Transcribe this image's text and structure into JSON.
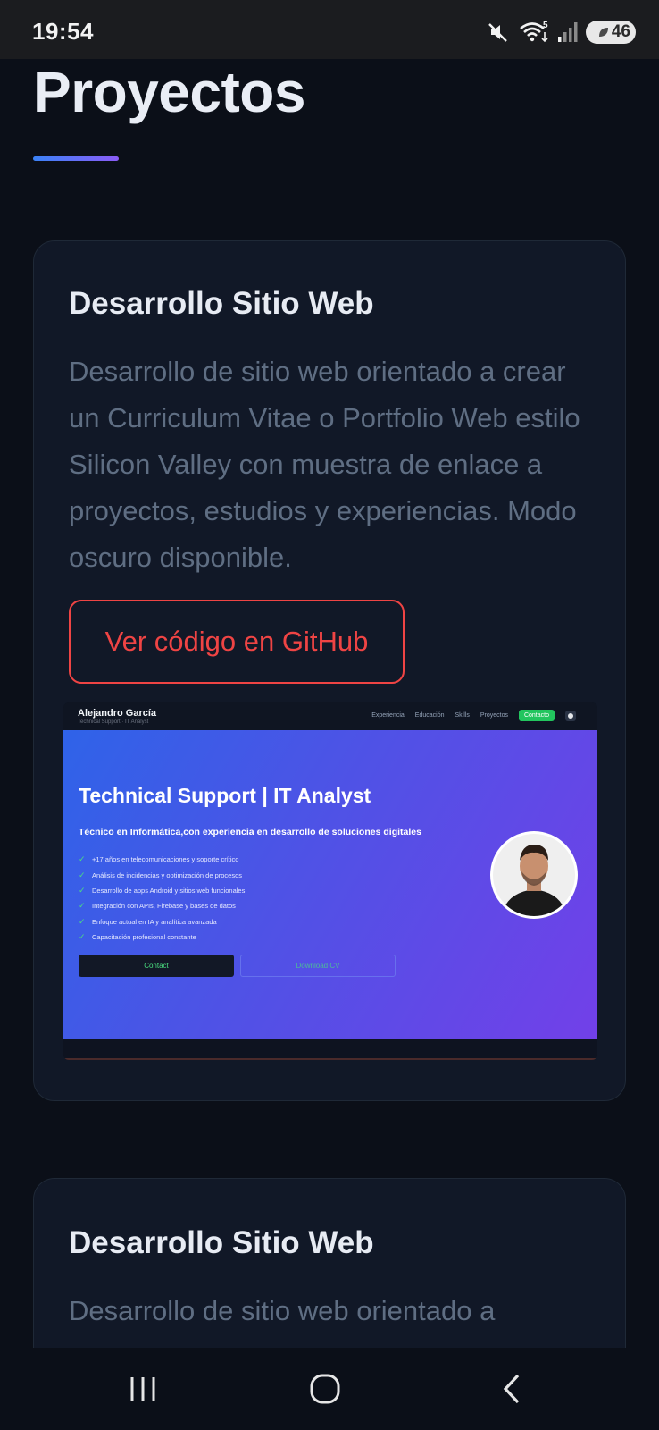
{
  "status_bar": {
    "time": "19:54",
    "battery": "46",
    "icons": [
      "mute-icon",
      "wifi-icon",
      "signal-icon",
      "battery-icon"
    ]
  },
  "page": {
    "title": "Proyectos"
  },
  "projects": [
    {
      "title": "Desarrollo Sitio Web",
      "description": "Desarrollo de sitio web orientado a crear un Curriculum Vitae o Portfolio Web estilo Silicon Valley con muestra de enlace a proyectos, estudios y experiencias. Modo oscuro disponible.",
      "github_button": "Ver código en GitHub",
      "preview": {
        "name": "Alejandro García",
        "subtitle": "Technical Support · IT Analyst",
        "nav_links": [
          "Experiencia",
          "Educación",
          "Skills",
          "Proyectos"
        ],
        "nav_contact": "Contacto",
        "hero_title": "Technical Support | IT Analyst",
        "hero_subtitle": "Técnico en Informática,con experiencia en desarrollo de soluciones digitales",
        "bullets": [
          "+17 años en telecomunicaciones y soporte crítico",
          "Análisis de incidencias y optimización de procesos",
          "Desarrollo de apps Android y sitios web funcionales",
          "Integración con APIs, Firebase y bases de datos",
          "Enfoque actual en IA y analítica avanzada",
          "Capacitación profesional constante"
        ],
        "check_glyph": "✓",
        "contact_button": "Contact",
        "download_button": "Download CV"
      }
    },
    {
      "title": "Desarrollo Sitio Web",
      "description": "Desarrollo de sitio web orientado a"
    }
  ],
  "colors": {
    "background": "#0b0f18",
    "card": "#111827",
    "accent_red": "#ef4444",
    "gradient_start": "#3b82f6",
    "gradient_end": "#8b5cf6"
  },
  "nav_bar": {
    "icons": [
      "recents-icon",
      "home-icon",
      "back-icon"
    ]
  }
}
